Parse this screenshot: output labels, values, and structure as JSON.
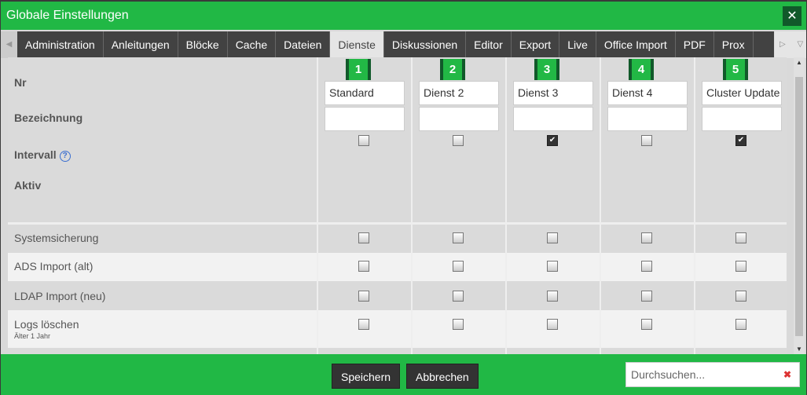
{
  "window": {
    "title": "Globale Einstellungen",
    "close_icon": "close-icon"
  },
  "tabs": [
    "Administration",
    "Anleitungen",
    "Blöcke",
    "Cache",
    "Dateien",
    "Dienste",
    "Diskussionen",
    "Editor",
    "Export",
    "Live",
    "Office Import",
    "PDF",
    "Prox"
  ],
  "active_tab": "Dienste",
  "labels": {
    "nr": "Nr",
    "bezeichnung": "Bezeichnung",
    "intervall": "Intervall",
    "aktiv": "Aktiv",
    "help": "?"
  },
  "columns": [
    {
      "nr": "1",
      "name": "Standard",
      "interval": "",
      "active": false
    },
    {
      "nr": "2",
      "name": "Dienst 2",
      "interval": "",
      "active": false
    },
    {
      "nr": "3",
      "name": "Dienst 3",
      "interval": "",
      "active": true
    },
    {
      "nr": "4",
      "name": "Dienst 4",
      "interval": "",
      "active": false
    },
    {
      "nr": "5",
      "name": "Cluster Update",
      "interval": "",
      "active": true
    }
  ],
  "rows": [
    {
      "name": "Systemsicherung",
      "sub": "",
      "checks": [
        false,
        false,
        false,
        false,
        false
      ]
    },
    {
      "name": "ADS Import (alt)",
      "sub": "",
      "checks": [
        false,
        false,
        false,
        false,
        false
      ]
    },
    {
      "name": "LDAP Import (neu)",
      "sub": "",
      "checks": [
        false,
        false,
        false,
        false,
        false
      ]
    },
    {
      "name": "Logs löschen",
      "sub": "Älter 1 Jahr",
      "checks": [
        false,
        false,
        false,
        false,
        false
      ]
    }
  ],
  "footer": {
    "save": "Speichern",
    "cancel": "Abbrechen",
    "search_placeholder": "Durchsuchen..."
  },
  "colors": {
    "accent": "#21b845",
    "dark": "#424242"
  }
}
